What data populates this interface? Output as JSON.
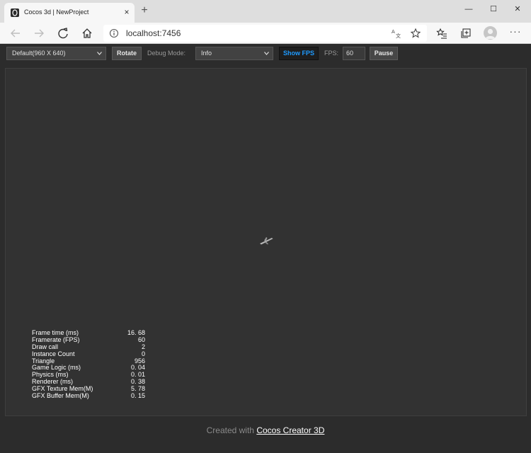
{
  "browser": {
    "tab_title": "Cocos 3d | NewProject",
    "tab_close": "×",
    "new_tab": "+",
    "url": "localhost:7456",
    "more": "···",
    "window_controls": {
      "minimize": "—",
      "maximize": "☐",
      "close": "✕"
    }
  },
  "toolbar": {
    "resolution_select": "Default(960 X 640)",
    "rotate_label": "Rotate",
    "debug_mode_label": "Debug Mode:",
    "debug_mode_value": "Info",
    "show_fps_label": "Show FPS",
    "fps_label": "FPS:",
    "fps_value": "60",
    "pause_label": "Pause",
    "accent_color": "#1e9bff"
  },
  "stats": [
    {
      "label": "Frame time (ms)",
      "value": "16. 68"
    },
    {
      "label": "Framerate (FPS)",
      "value": "60"
    },
    {
      "label": "Draw call",
      "value": "2"
    },
    {
      "label": "Instance Count",
      "value": "0"
    },
    {
      "label": "Triangle",
      "value": "956"
    },
    {
      "label": "Game Logic (ms)",
      "value": "0. 04"
    },
    {
      "label": "Physics (ms)",
      "value": "0. 01"
    },
    {
      "label": "Renderer (ms)",
      "value": "0. 38"
    },
    {
      "label": "GFX Texture Mem(M)",
      "value": "5. 78"
    },
    {
      "label": "GFX Buffer Mem(M)",
      "value": "0. 15"
    }
  ],
  "footer": {
    "prefix": "Created with",
    "link": "Cocos Creator 3D"
  }
}
